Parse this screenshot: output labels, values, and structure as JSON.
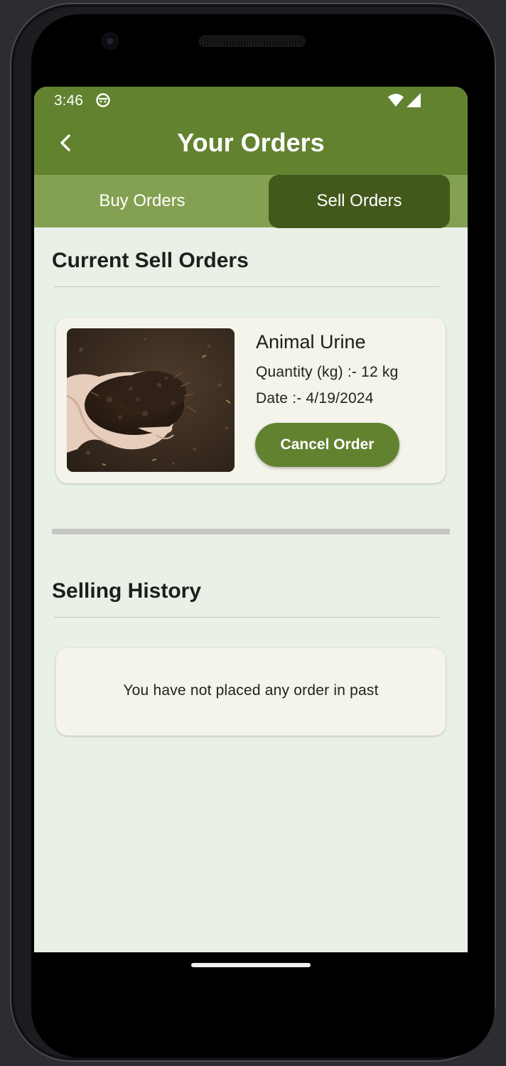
{
  "status_bar": {
    "time": "3:46"
  },
  "header": {
    "title": "Your Orders"
  },
  "tabs": [
    {
      "label": "Buy Orders",
      "selected": false
    },
    {
      "label": "Sell Orders",
      "selected": true
    }
  ],
  "current_orders": {
    "title": "Current Sell Orders",
    "items": [
      {
        "name": "Animal Urine",
        "quantity": "Quantity (kg) :- 12 kg",
        "date": "Date :- 4/19/2024",
        "action_label": "Cancel Order"
      }
    ]
  },
  "history": {
    "title": "Selling History",
    "empty_message": "You have not placed any order in past"
  },
  "colors": {
    "app_bar": "#628230",
    "tab_bar": "#84a052",
    "tab_selected": "#43591c",
    "background": "#e9f0e6",
    "card": "#f4f4ea",
    "button": "#628230"
  },
  "icons": {
    "back": "back-arrow-icon",
    "status_app": "notification-app-icon",
    "wifi": "wifi-icon",
    "signal": "cellular-signal-icon"
  }
}
